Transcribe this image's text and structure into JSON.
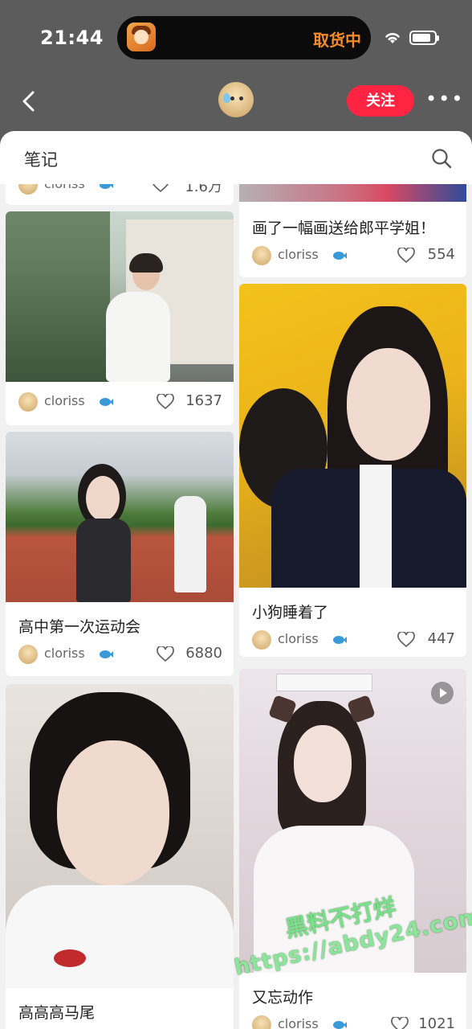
{
  "status_bar": {
    "time": "21:44",
    "live_activity": "取货中"
  },
  "nav": {
    "follow_label": "关注"
  },
  "sheet": {
    "title": "笔记"
  },
  "notes_left": [
    {
      "author": "cloriss",
      "likes": "1.6万"
    },
    {
      "author": "cloriss",
      "likes": "1637"
    },
    {
      "title": "高中第一次运动会",
      "author": "cloriss",
      "likes": "6880"
    },
    {
      "title": "高高高马尾"
    }
  ],
  "notes_right": [
    {
      "title": "画了一幅画送给郎平学姐！",
      "author": "cloriss",
      "likes": "554"
    },
    {
      "title": "小狗睡着了",
      "author": "cloriss",
      "likes": "447"
    },
    {
      "title": "又忘动作",
      "author": "cloriss",
      "likes": "1021"
    }
  ],
  "watermark": {
    "line1": "黑料不打烊",
    "line2": "https://abdy24.com"
  },
  "colors": {
    "accent": "#ff2442",
    "live_activity": "#f28b2a"
  }
}
